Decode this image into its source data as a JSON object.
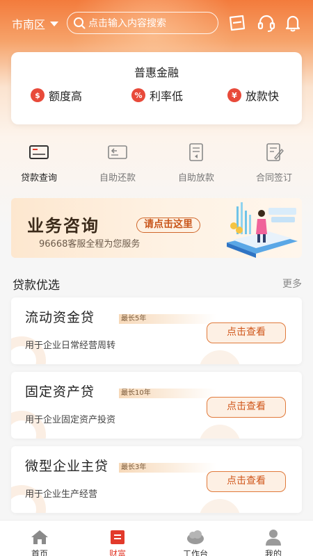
{
  "header": {
    "city": "市南区",
    "search_placeholder": "点击输入内容搜索",
    "icons": [
      "scan-icon",
      "headset-icon",
      "bell-icon"
    ]
  },
  "finance": {
    "title": "普惠金融",
    "features": [
      {
        "icon": "money-bag-icon",
        "label": "额度高"
      },
      {
        "icon": "percent-icon",
        "label": "利率低"
      },
      {
        "icon": "hand-coin-icon",
        "label": "放款快"
      }
    ]
  },
  "quick_actions": [
    {
      "icon": "card-search-icon",
      "label": "贷款查询"
    },
    {
      "icon": "card-return-icon",
      "label": "自助还款"
    },
    {
      "icon": "doc-release-icon",
      "label": "自助放款"
    },
    {
      "icon": "contract-sign-icon",
      "label": "合同签订"
    }
  ],
  "banner": {
    "title": "业务咨询",
    "cta": "请点击这里",
    "subtitle": "96668客服全程为您服务"
  },
  "section": {
    "title": "贷款优选",
    "more": "更多"
  },
  "loans": [
    {
      "name": "流动资金贷",
      "tag": "最长5年",
      "desc": "用于企业日常经营周转",
      "button": "点击查看"
    },
    {
      "name": "固定资产贷",
      "tag": "最长10年",
      "desc": "用于企业固定资产投资",
      "button": "点击查看"
    },
    {
      "name": "微型企业主贷",
      "tag": "最长3年",
      "desc": "用于企业生产经营",
      "button": "点击查看"
    }
  ],
  "tabs": [
    {
      "icon": "home-icon",
      "label": "首页"
    },
    {
      "icon": "wealth-icon",
      "label": "财富"
    },
    {
      "icon": "workbench-icon",
      "label": "工作台"
    },
    {
      "icon": "user-icon",
      "label": "我的"
    }
  ],
  "colors": {
    "accent": "#f37b3c",
    "active_tab": "#e23a2b",
    "feature_icon": "#e84a3a"
  }
}
